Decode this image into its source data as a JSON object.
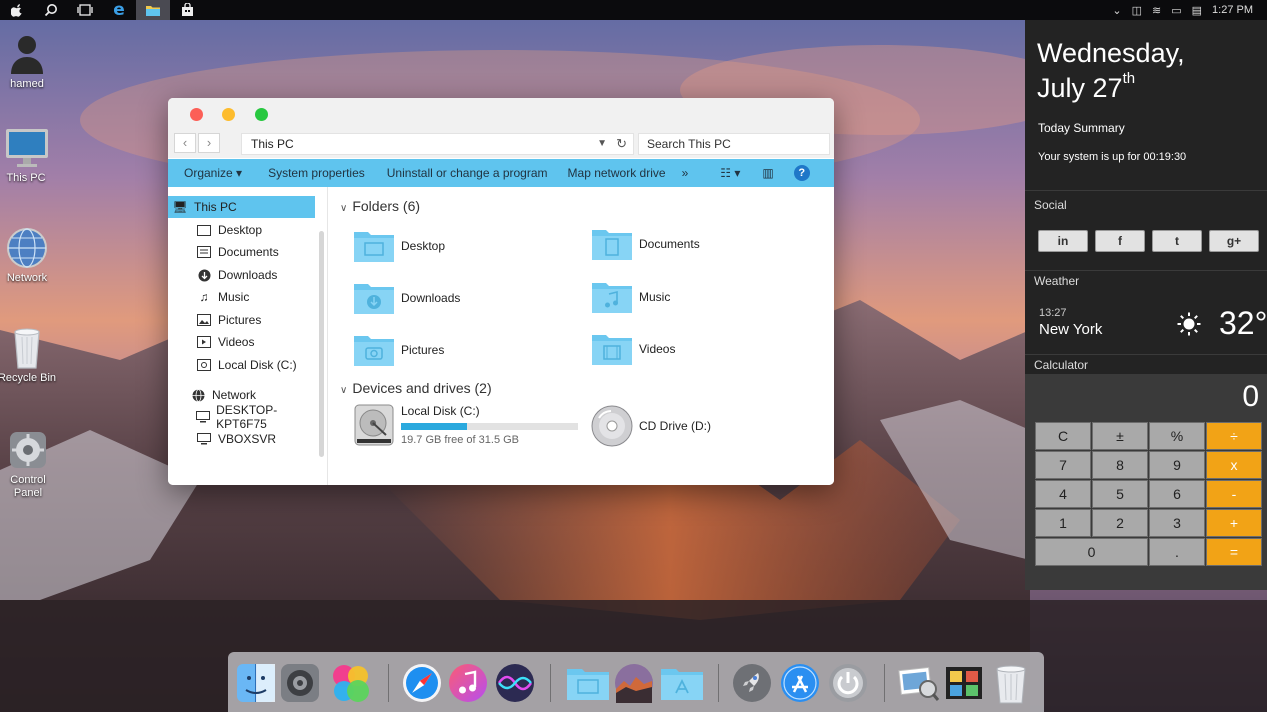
{
  "taskbar": {
    "icons": [
      {
        "name": "apple-icon",
        "glyph": ""
      },
      {
        "name": "search-icon",
        "glyph": "⌕"
      },
      {
        "name": "task-view-icon",
        "glyph": "▭"
      },
      {
        "name": "edge-icon",
        "glyph": "e"
      },
      {
        "name": "file-explorer-icon",
        "glyph": "▰"
      },
      {
        "name": "store-icon",
        "glyph": "▣"
      }
    ],
    "clock": "1:27 PM"
  },
  "desktop_icons": [
    {
      "label": "hamed",
      "icon": "user-icon"
    },
    {
      "label": "This PC",
      "icon": "monitor-icon"
    },
    {
      "label": "Network",
      "icon": "network-globe-icon"
    },
    {
      "label": "Recycle Bin",
      "icon": "recycle-bin-icon"
    },
    {
      "label": "Control Panel",
      "icon": "control-panel-icon"
    }
  ],
  "explorer": {
    "address": "This PC",
    "search_placeholder": "Search This PC",
    "commands": [
      "Organize ▾",
      "System properties",
      "Uninstall or change a program",
      "Map network drive",
      "»"
    ],
    "nav_items": [
      {
        "label": "This PC",
        "icon": "monitor-icon",
        "selected": true
      },
      {
        "label": "Desktop",
        "icon": "desktop-icon"
      },
      {
        "label": "Documents",
        "icon": "documents-icon"
      },
      {
        "label": "Downloads",
        "icon": "downloads-icon"
      },
      {
        "label": "Music",
        "icon": "music-icon"
      },
      {
        "label": "Pictures",
        "icon": "pictures-icon"
      },
      {
        "label": "Videos",
        "icon": "videos-icon"
      },
      {
        "label": "Local Disk (C:)",
        "icon": "disk-icon"
      },
      {
        "label": "Network",
        "icon": "network-icon"
      },
      {
        "label": "DESKTOP-KPT6F75",
        "icon": "computer-icon"
      },
      {
        "label": "VBOXSVR",
        "icon": "computer-icon"
      }
    ],
    "folders_header": "Folders (6)",
    "folders": [
      "Desktop",
      "Documents",
      "Downloads",
      "Music",
      "Pictures",
      "Videos"
    ],
    "devices_header": "Devices and drives (2)",
    "drives": [
      {
        "name": "Local Disk (C:)",
        "free_text": "19.7 GB free of 31.5 GB",
        "used_fraction": 0.375
      },
      {
        "name": "CD Drive (D:)"
      }
    ]
  },
  "sidebar": {
    "day": "Wednesday,",
    "date": "July 27",
    "date_suffix": "th",
    "today_title": "Today Summary",
    "uptime": "Your system is up for 00:19:30",
    "social_title": "Social",
    "social_buttons": [
      "in",
      "f",
      "t",
      "g+"
    ],
    "weather_title": "Weather",
    "weather_time": "13:27",
    "weather_city": "New York",
    "weather_temp": "32°",
    "calculator_title": "Calculator",
    "calc_display": "0",
    "calc_keys": [
      [
        "C",
        "±",
        "%",
        "÷"
      ],
      [
        "7",
        "8",
        "9",
        "x"
      ],
      [
        "4",
        "5",
        "6",
        "-"
      ],
      [
        "1",
        "2",
        "3",
        "+"
      ],
      [
        "0",
        ".",
        "="
      ]
    ]
  },
  "dock": {
    "items": [
      "finder-icon",
      "system-preferences-icon",
      "game-center-icon",
      "safari-icon",
      "itunes-icon",
      "siri-icon",
      "folder-icon",
      "sierra-wallpaper-icon",
      "applications-folder-icon",
      "launchpad-icon",
      "app-store-icon",
      "power-icon",
      "preview-icon",
      "photo-booth-icon",
      "trash-icon"
    ]
  },
  "colors": {
    "accent": "#5fc4ee",
    "calc_orange": "#f2a316",
    "panel_bg": "#232323"
  }
}
